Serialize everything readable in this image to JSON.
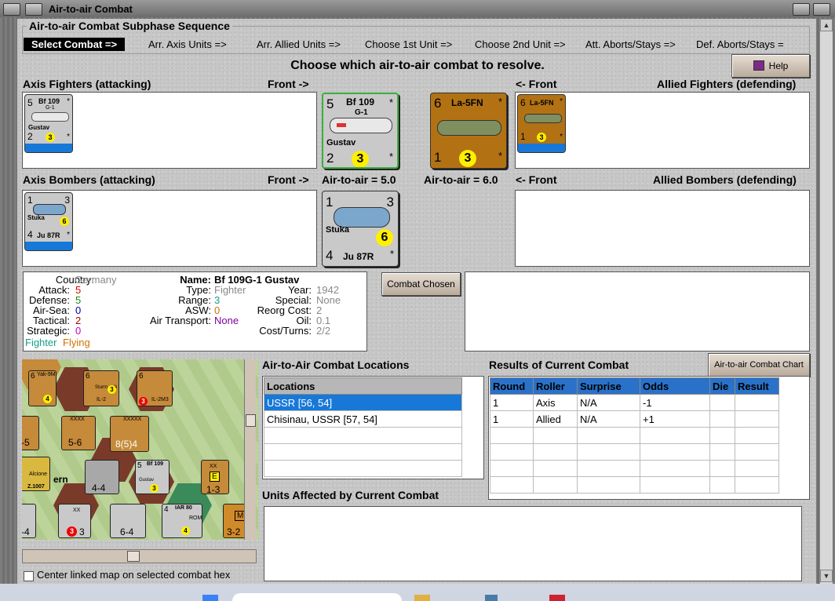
{
  "window": {
    "title": "Air-to-air Combat"
  },
  "subphase": {
    "title": "Air-to-air Combat Subphase Sequence",
    "steps": [
      "Select Combat =>",
      "Arr. Axis Units =>",
      "Arr. Allied Units =>",
      "Choose 1st Unit =>",
      "Choose 2nd Unit =>",
      "Att. Aborts/Stays =>",
      "Def. Aborts/Stays ="
    ]
  },
  "headline": "Choose which air-to-air combat to resolve.",
  "help_label": "Help",
  "labels": {
    "axis_fighters": "Axis Fighters (attacking)",
    "front_right": "Front ->",
    "front_left": "<- Front",
    "allied_fighters": "Allied Fighters (defending)",
    "axis_bombers": "Axis Bombers (attacking)",
    "allied_bombers": "Allied Bombers (defending)",
    "axis_a2a": "Air-to-air = 5.0",
    "allied_a2a": "Air-to-air = 6.0"
  },
  "units": {
    "bf109": {
      "attack": "5",
      "defense": "2",
      "name": "Bf 109",
      "variant": "G-1",
      "nick": "Gustav",
      "moves": "3",
      "star": "*"
    },
    "la5": {
      "attack": "6",
      "defense": "1",
      "name": "La-5FN",
      "moves": "3",
      "star": "*"
    },
    "stuka": {
      "tl": "1",
      "tr": "3",
      "bl": "4",
      "nick": "Stuka",
      "name": "Ju 87R",
      "moves": "6",
      "star": "*"
    }
  },
  "info": {
    "country_lbl": "Country:",
    "country": "Germany",
    "attack_lbl": "Attack:",
    "attack": "5",
    "defense_lbl": "Defense:",
    "defense": "5",
    "airsea_lbl": "Air-Sea:",
    "airsea": "0",
    "tactical_lbl": "Tactical:",
    "tactical": "2",
    "strategic_lbl": "Strategic:",
    "strategic": "0",
    "fighter": "Fighter",
    "flying": "Flying",
    "name_lbl": "Name:",
    "name": "Bf 109G-1 Gustav",
    "type_lbl": "Type:",
    "type": "Fighter",
    "range_lbl": "Range:",
    "range": "3",
    "asw_lbl": "ASW:",
    "asw": "0",
    "airtrans_lbl": "Air Transport:",
    "airtrans": "None",
    "year_lbl": "Year:",
    "year": "1942",
    "special_lbl": "Special:",
    "special": "None",
    "reorg_lbl": "Reorg Cost:",
    "reorg": "2",
    "oil_lbl": "Oil:",
    "oil": "0.1",
    "cost_lbl": "Cost/Turns:",
    "cost": "2/2"
  },
  "combat_chosen_label": "Combat Chosen",
  "locations": {
    "title": "Air-to-Air Combat Locations",
    "header": "Locations",
    "rows": [
      "USSR [56, 54]",
      "Chisinau, USSR [57, 54]"
    ]
  },
  "results": {
    "title": "Results of Current Combat",
    "chart_button": "Air-to-air Combat Chart",
    "headers": [
      "Round",
      "Roller",
      "Surprise",
      "Odds",
      "Die",
      "Result"
    ],
    "rows": [
      [
        "1",
        "Axis",
        "N/A",
        "-1",
        "",
        ""
      ],
      [
        "1",
        "Allied",
        "N/A",
        "+1",
        "",
        ""
      ]
    ]
  },
  "affected": {
    "title": "Units Affected by Current Combat"
  },
  "center_map_label": "Center linked map on selected combat hex",
  "map_counters": {
    "yak": "Yak-9M",
    "il2": "IL-2",
    "il2m3": "IL-2M3",
    "bf": "Bf 109",
    "iar": "IAR 80",
    "sturm": "Sturm ovik",
    "aloione": "Alcione",
    "z1007": "Z.1007",
    "gustav": "Gustav",
    "rom": "ROM",
    "c1": "5-6",
    "c2": "8(5)4",
    "c3": "4-4",
    "c4": "1-3",
    "c5": "6-4",
    "c6": "-5",
    "c7": "-4",
    "c8": "3-2",
    "c9": "3",
    "xx": "XX",
    "xxxx": "XXXX",
    "xxxxx": "XXXXX",
    "xxx": "XXX",
    "n6": "6",
    "n5": "5",
    "n4": "4",
    "n3": "3",
    "n2": "2",
    "n1": "1",
    "e": "E",
    "ern": "ern",
    "m": "M"
  }
}
